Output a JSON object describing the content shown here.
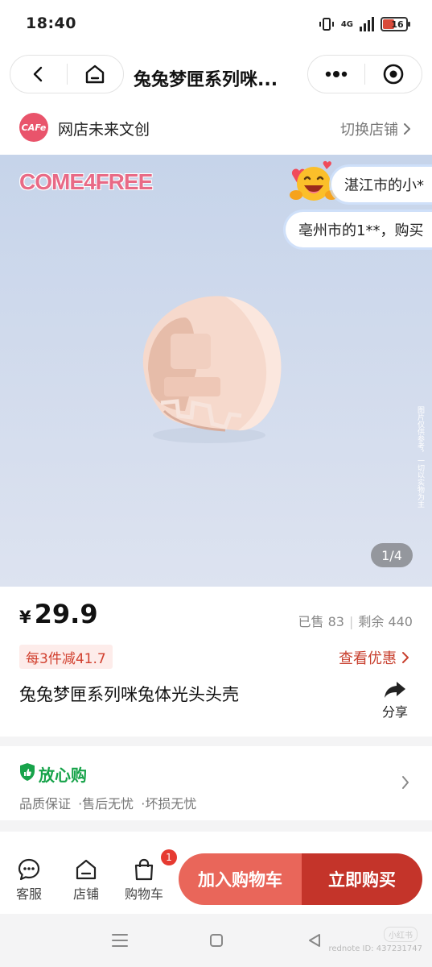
{
  "status_bar": {
    "time": "18:40",
    "network": "4G",
    "battery": "16"
  },
  "nav": {
    "title": "兔兔梦匣系列咪..."
  },
  "store": {
    "logo_text": "CAFe",
    "name": "网店未来文创",
    "switch_label": "切换店铺"
  },
  "hero": {
    "brand_logo": "COME4FREE",
    "disclaimer": "图片仅供参考，一切以实物为主",
    "counter": "1/4",
    "notices": [
      "湛江市的小*",
      "亳州市的1**，购买"
    ]
  },
  "product": {
    "currency": "¥",
    "price": "29.9",
    "sold": "已售 83",
    "remaining": "剩余 440",
    "promo": "每3件减41.7",
    "coupon_link": "查看优惠",
    "title": "兔兔梦匣系列咪兔体光头头壳",
    "share_label": "分享"
  },
  "guarantee": {
    "title": "放心购",
    "subtitle": "品质保证 ·售后无忧 ·坏损无忧"
  },
  "actions": {
    "service": "客服",
    "shop": "店铺",
    "cart": "购物车",
    "cart_count": "1",
    "add_to_cart": "加入购物车",
    "buy_now": "立即购买"
  },
  "watermark": {
    "logo": "小红书",
    "text": "rednote ID: 437231747"
  },
  "colors": {
    "accent_red": "#c4342a",
    "light_red": "#e9665a",
    "green": "#17a34a"
  }
}
